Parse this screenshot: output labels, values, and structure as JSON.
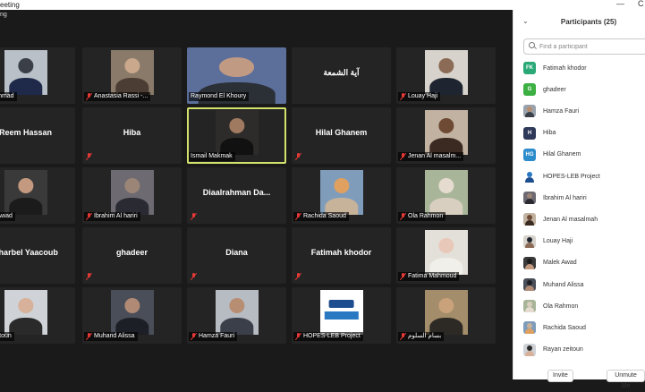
{
  "window": {
    "title": "eeting",
    "subtitle": "ng",
    "minimize_glyph": "—",
    "close_glyph": "C"
  },
  "tiles": [
    {
      "name": "fa Ahmad",
      "photo": true,
      "muted": true,
      "photo_colors": [
        "#b9c0c8",
        "#3a3f48",
        "#1f2a4a"
      ]
    },
    {
      "name": "Anastasia Rassi -...",
      "photo": true,
      "muted": true,
      "photo_colors": [
        "#8a7a6a",
        "#c9a88c",
        "#4b3d33"
      ]
    },
    {
      "name": "Raymond El Khoury",
      "photo": true,
      "wide": true,
      "muted": false,
      "photo_colors": [
        "#5b6f9a",
        "#c19a83",
        "#2b2f36"
      ]
    },
    {
      "name": "آية الشمعة",
      "photo": false,
      "muted": false
    },
    {
      "name": "Louay Haji",
      "photo": true,
      "muted": true,
      "photo_colors": [
        "#d7d3cc",
        "#8b6b55",
        "#1f2530"
      ]
    },
    {
      "name": "Reem Hassan",
      "photo": false,
      "muted": false
    },
    {
      "name": "Hiba",
      "photo": false,
      "muted": true
    },
    {
      "name": "Ismail Makmak",
      "photo": true,
      "muted": false,
      "active": true,
      "photo_colors": [
        "#2d2c2a",
        "#a07a60",
        "#111111"
      ]
    },
    {
      "name": "Hilal Ghanem",
      "photo": false,
      "muted": true
    },
    {
      "name": "Jenan Al masalm...",
      "photo": true,
      "muted": true,
      "photo_colors": [
        "#c2b2a2",
        "#6e4a34",
        "#3a2a22"
      ]
    },
    {
      "name": "lek Awad",
      "photo": true,
      "muted": true,
      "photo_colors": [
        "#3a3a3a",
        "#c39a80",
        "#1b1b1b"
      ]
    },
    {
      "name": "Ibrahim Al hariri",
      "photo": true,
      "muted": true,
      "photo_colors": [
        "#6d6a72",
        "#9b8576",
        "#2a2a33"
      ]
    },
    {
      "name": "Diaalrahman  Da...",
      "photo": false,
      "muted": true
    },
    {
      "name": "Rachida Saoud",
      "photo": true,
      "muted": true,
      "photo_colors": [
        "#7f9dbb",
        "#e0a060",
        "#c7b29a"
      ]
    },
    {
      "name": "Ola Rahmon",
      "photo": true,
      "muted": true,
      "photo_colors": [
        "#a8b598",
        "#e5dccf",
        "#d8cfc0"
      ]
    },
    {
      "name": "Charbel Yaacoub",
      "photo": false,
      "muted": false
    },
    {
      "name": "ghadeer",
      "photo": false,
      "muted": true
    },
    {
      "name": "Diana",
      "photo": false,
      "muted": true
    },
    {
      "name": "Fatimah khodor",
      "photo": false,
      "muted": true
    },
    {
      "name": "Fatima Mahmoud",
      "photo": true,
      "muted": true,
      "photo_colors": [
        "#e3e0da",
        "#e8c8b8",
        "#f1efe9"
      ]
    },
    {
      "name": "yan zeitoun",
      "photo": true,
      "muted": false,
      "photo_colors": [
        "#cfd2d6",
        "#d7b19a",
        "#2a2a2a"
      ]
    },
    {
      "name": "Muhand Alissa",
      "photo": true,
      "muted": true,
      "photo_colors": [
        "#4a4e58",
        "#b08a74",
        "#1d1f26"
      ]
    },
    {
      "name": "Hamza Fauri",
      "photo": true,
      "muted": true,
      "photo_colors": [
        "#b7bcc3",
        "#b88e73",
        "#3b3f4a"
      ]
    },
    {
      "name": "HOPES-LEB Project",
      "photo": true,
      "logo": true,
      "muted": true,
      "photo_colors": [
        "#ffffff",
        "#1d4d8f",
        "#2a78c2"
      ]
    },
    {
      "name": "بسام السلوم",
      "photo": true,
      "muted": true,
      "photo_colors": [
        "#a38d6a",
        "#c9a27c",
        "#2d2a26"
      ]
    }
  ],
  "panel": {
    "title": "Participants (25)",
    "collapse_icon": "chevron-down-icon",
    "search_placeholder": "Find a participant",
    "invite_label": "Invite",
    "unmute_label": "Unmute Me",
    "participants": [
      {
        "name": "Fatimah khodor",
        "initials": "FK",
        "color": "#2aa876"
      },
      {
        "name": "ghadeer",
        "initials": "G",
        "color": "#3cb043"
      },
      {
        "name": "Hamza Fauri",
        "initials": "",
        "color": "#9aa3ad",
        "img": [
          "#3a3f48",
          "#b88e73"
        ]
      },
      {
        "name": "Hiba",
        "initials": "H",
        "color": "#2f3a5a"
      },
      {
        "name": "Hilal Ghanem",
        "initials": "HG",
        "color": "#2d8ccc"
      },
      {
        "name": "HOPES-LEB Project",
        "initials": "",
        "color": "#ffffff",
        "img": [
          "#1d4d8f",
          "#2a78c2"
        ]
      },
      {
        "name": "Ibrahim Al hariri",
        "initials": "",
        "color": "#6d6a72",
        "img": [
          "#2a2a33",
          "#9b8576"
        ]
      },
      {
        "name": "Jenan Al masalmah",
        "initials": "",
        "color": "#c2b2a2",
        "img": [
          "#3a2a22",
          "#6e4a34"
        ]
      },
      {
        "name": "Louay Haji",
        "initials": "",
        "color": "#d7d3cc",
        "img": [
          "#8b6b55",
          "#1f2530"
        ]
      },
      {
        "name": "Malek Awad",
        "initials": "",
        "color": "#3a3a3a",
        "img": [
          "#c39a80",
          "#1b1b1b"
        ]
      },
      {
        "name": "Muhand Alissa",
        "initials": "",
        "color": "#4a4e58",
        "img": [
          "#b08a74",
          "#1d1f26"
        ]
      },
      {
        "name": "Ola Rahmon",
        "initials": "",
        "color": "#a8b598",
        "img": [
          "#e5dccf",
          "#d8cfc0"
        ]
      },
      {
        "name": "Rachida Saoud",
        "initials": "",
        "color": "#7f9dbb",
        "img": [
          "#e0a060",
          "#c7b29a"
        ]
      },
      {
        "name": "Rayan zeitoun",
        "initials": "",
        "color": "#cfd2d6",
        "img": [
          "#d7b19a",
          "#2a2a2a"
        ]
      }
    ]
  }
}
